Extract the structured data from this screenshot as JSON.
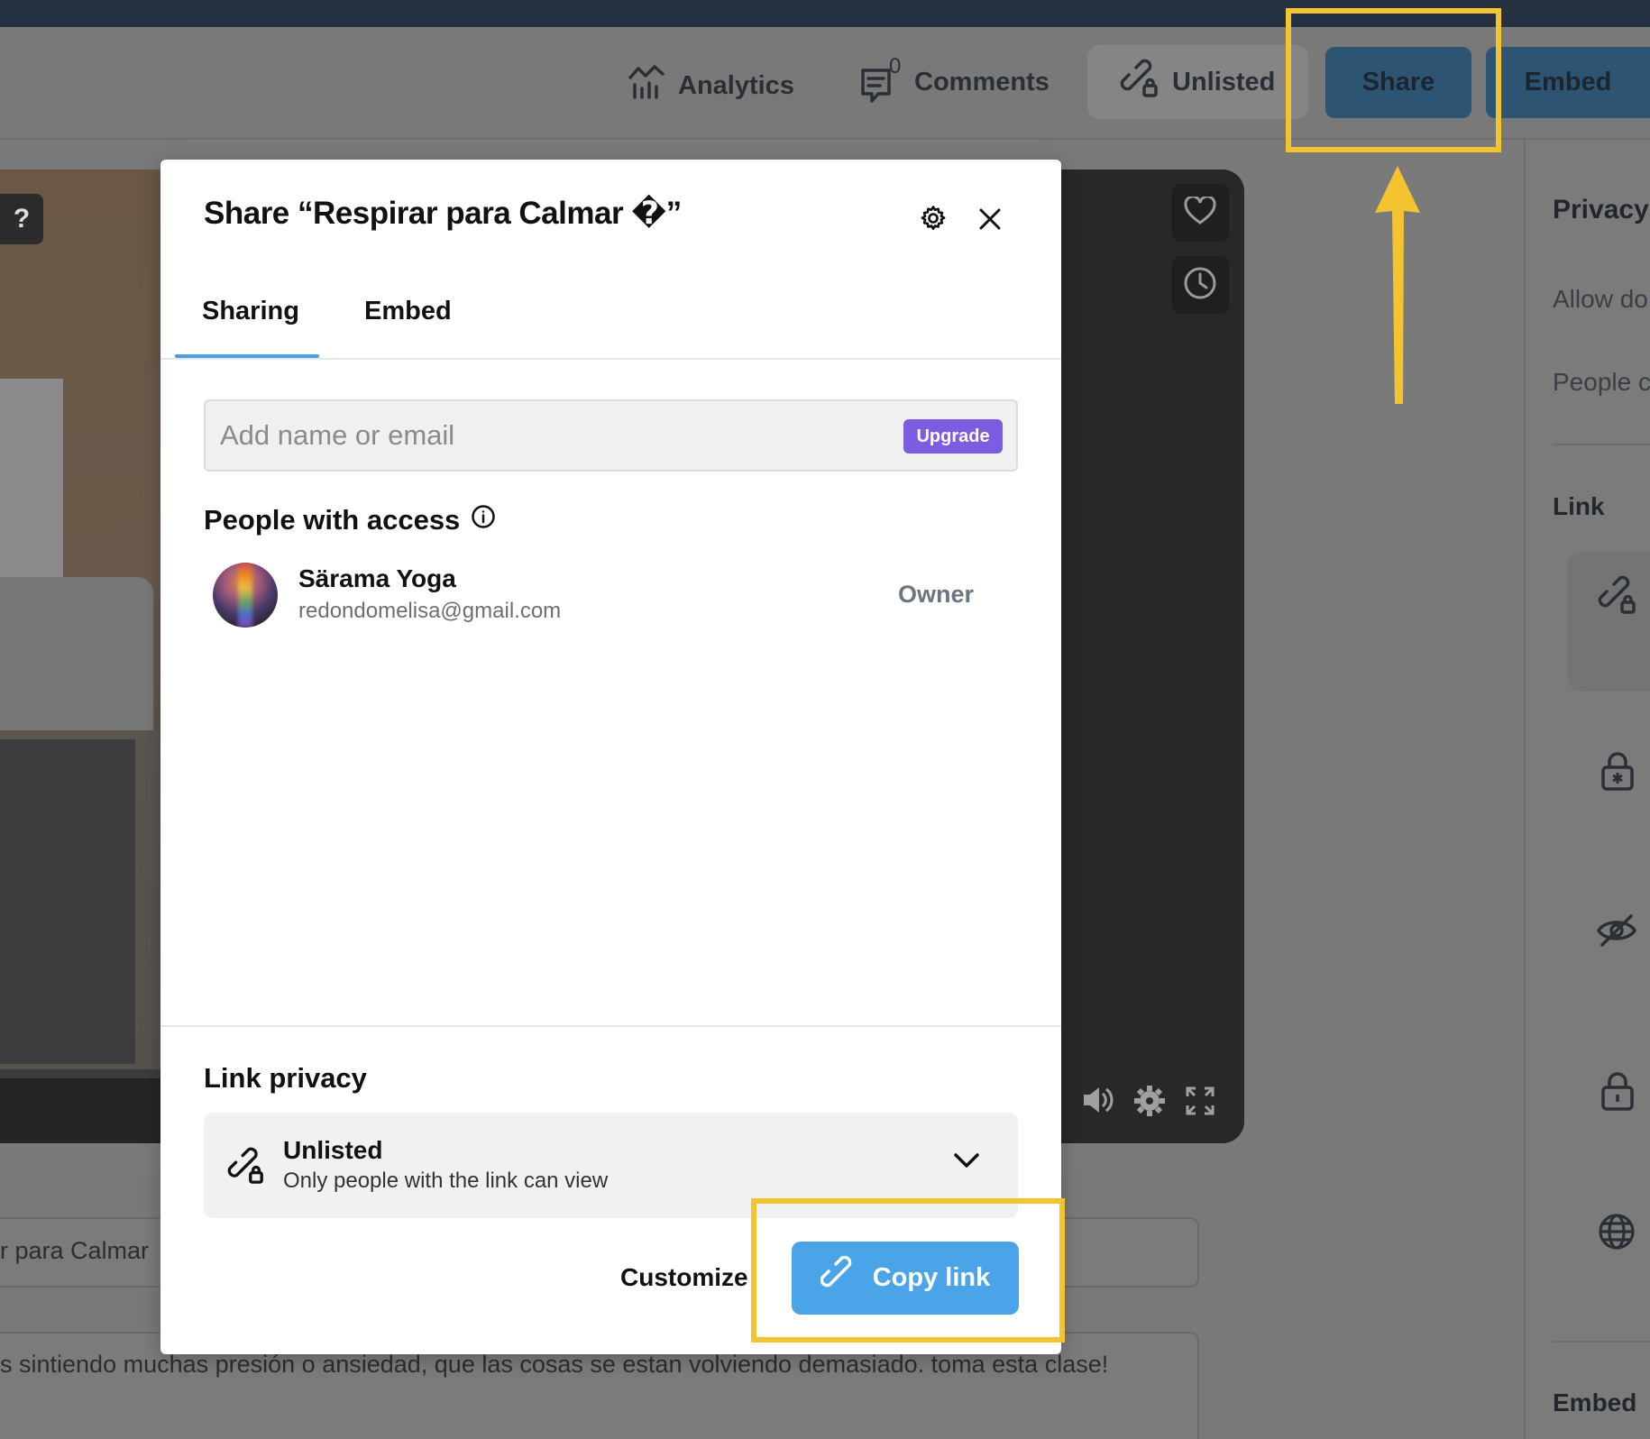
{
  "toolbar": {
    "analytics_label": "Analytics",
    "comments_label": "Comments",
    "comments_count": "0",
    "unlisted_label": "Unlisted",
    "share_label": "Share",
    "embed_label": "Embed"
  },
  "right_panel": {
    "privacy_title": "Privacy",
    "allow_text": "Allow do",
    "people_text": "People c",
    "link_title": "Link",
    "embed_title": "Embed"
  },
  "background": {
    "title_field_text": "r para Calmar",
    "description_text": "s sintiendo muchas presión o ansiedad, que las cosas se estan volviendo demasiado. toma esta clase!"
  },
  "modal": {
    "title": "Share “Respirar para Calmar �”",
    "tabs": [
      {
        "label": "Sharing",
        "active": true
      },
      {
        "label": "Embed",
        "active": false
      }
    ],
    "input_placeholder": "Add name or email",
    "upgrade_label": "Upgrade",
    "people_title": "People with access",
    "people": [
      {
        "name": "Särama Yoga",
        "email": "redondomelisa@gmail.com",
        "role": "Owner"
      }
    ],
    "link_privacy_title": "Link privacy",
    "privacy_option": {
      "title": "Unlisted",
      "subtitle": "Only people with the link can view"
    },
    "customize_label": "Customize",
    "copy_link_label": "Copy link"
  },
  "colors": {
    "accent_blue": "#4ba4e7",
    "upgrade_purple": "#7e5ce0",
    "highlight_yellow": "#f4c430",
    "share_button": "#2d5473"
  }
}
